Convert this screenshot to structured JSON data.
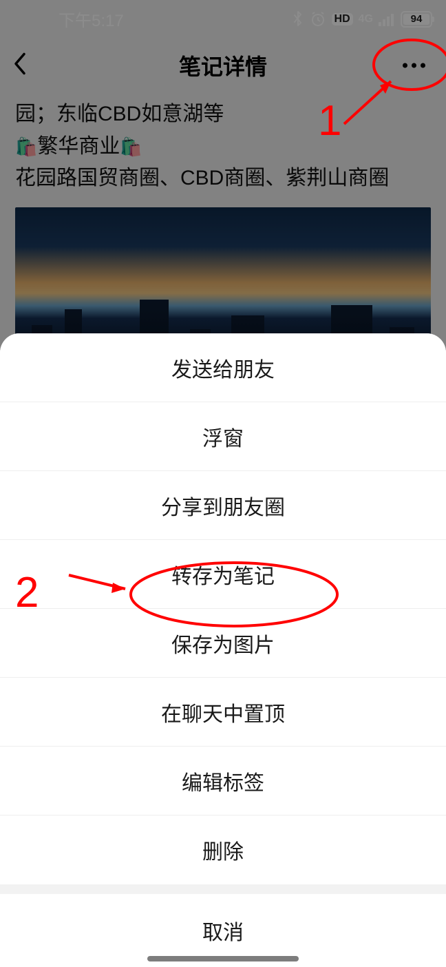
{
  "status": {
    "time": "下午5:17",
    "network_label": "4G",
    "hd_label": "HD",
    "battery_percent": "94"
  },
  "nav": {
    "title": "笔记详情"
  },
  "content": {
    "line1": "园；东临CBD如意湖等",
    "line2_prefix": "🛍️",
    "line2_text": "繁华商业",
    "line2_suffix": "🛍️",
    "line3": "花园路国贸商圈、CBD商圈、紫荆山商圈"
  },
  "sheet": {
    "items": [
      "发送给朋友",
      "浮窗",
      "分享到朋友圈",
      "转存为笔记",
      "保存为图片",
      "在聊天中置顶",
      "编辑标签",
      "删除"
    ],
    "cancel": "取消"
  },
  "annotations": {
    "label1": "1",
    "label2": "2"
  }
}
